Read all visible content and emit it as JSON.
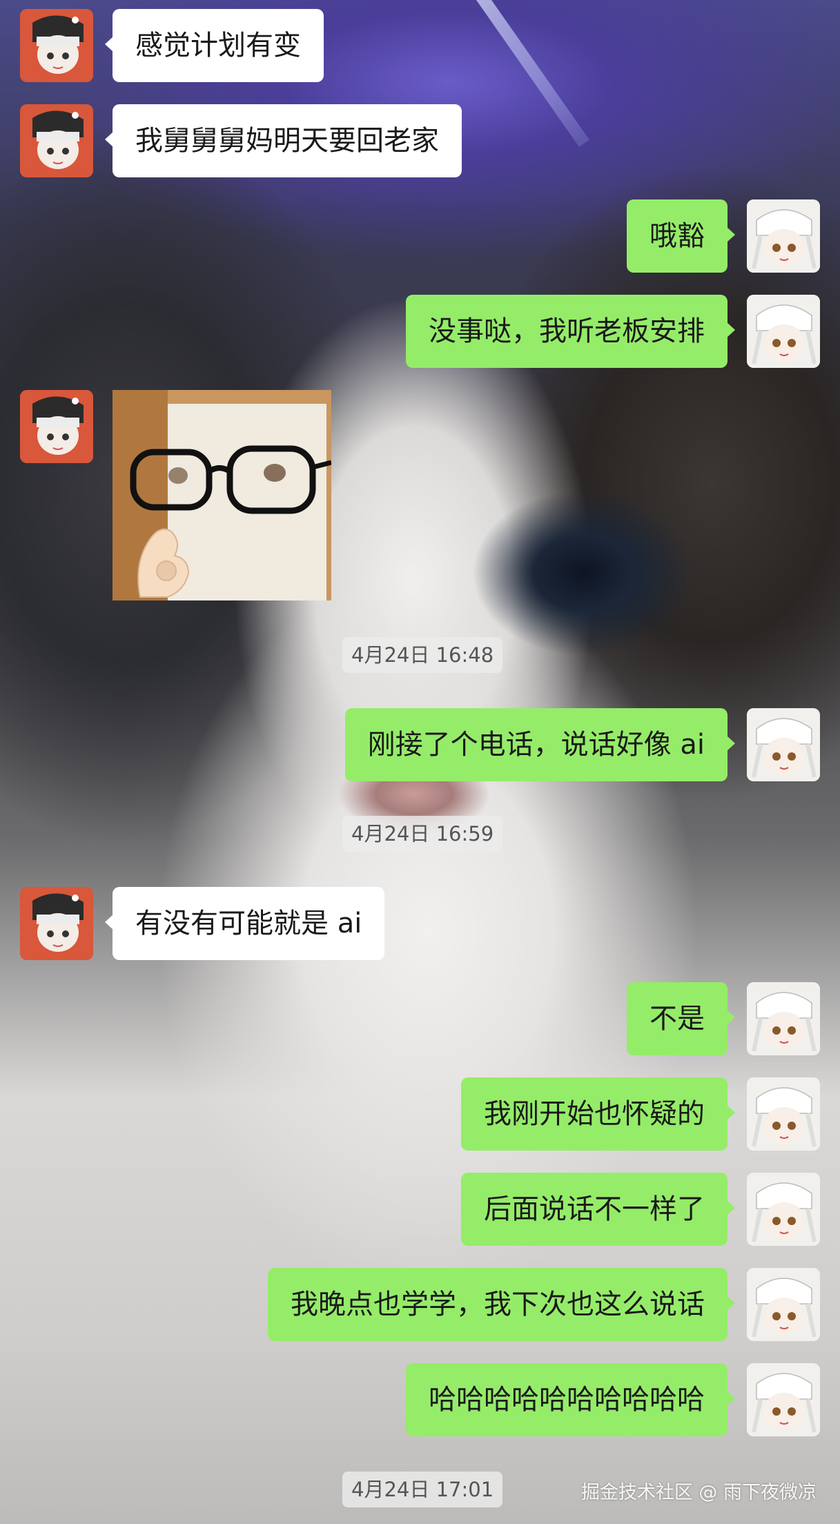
{
  "chat": {
    "messages": [
      {
        "side": "left",
        "text": "感觉计划有变"
      },
      {
        "side": "left",
        "text": "我舅舅舅妈明天要回老家"
      },
      {
        "side": "right",
        "text": "哦豁"
      },
      {
        "side": "right",
        "text": "没事哒，我听老板安排"
      },
      {
        "side": "left",
        "sticker": "glasses-ok-sticker"
      },
      {
        "side": "right",
        "text": "刚接了个电话，说话好像 ai"
      },
      {
        "side": "left",
        "text": "有没有可能就是 ai"
      },
      {
        "side": "right",
        "text": "不是"
      },
      {
        "side": "right",
        "text": "我刚开始也怀疑的"
      },
      {
        "side": "right",
        "text": "后面说话不一样了"
      },
      {
        "side": "right",
        "text": "我晚点也学学，我下次也这么说话"
      },
      {
        "side": "right",
        "text": "哈哈哈哈哈哈哈哈哈哈"
      }
    ],
    "timestamps": [
      "4月24日 16:48",
      "4月24日 16:59",
      "4月24日 17:01"
    ]
  },
  "watermark": "掘金技术社区 @ 雨下夜微凉",
  "colors": {
    "sent_bubble": "#95ec69",
    "received_bubble": "#ffffff",
    "timestamp_bg": "#ebebeb"
  }
}
